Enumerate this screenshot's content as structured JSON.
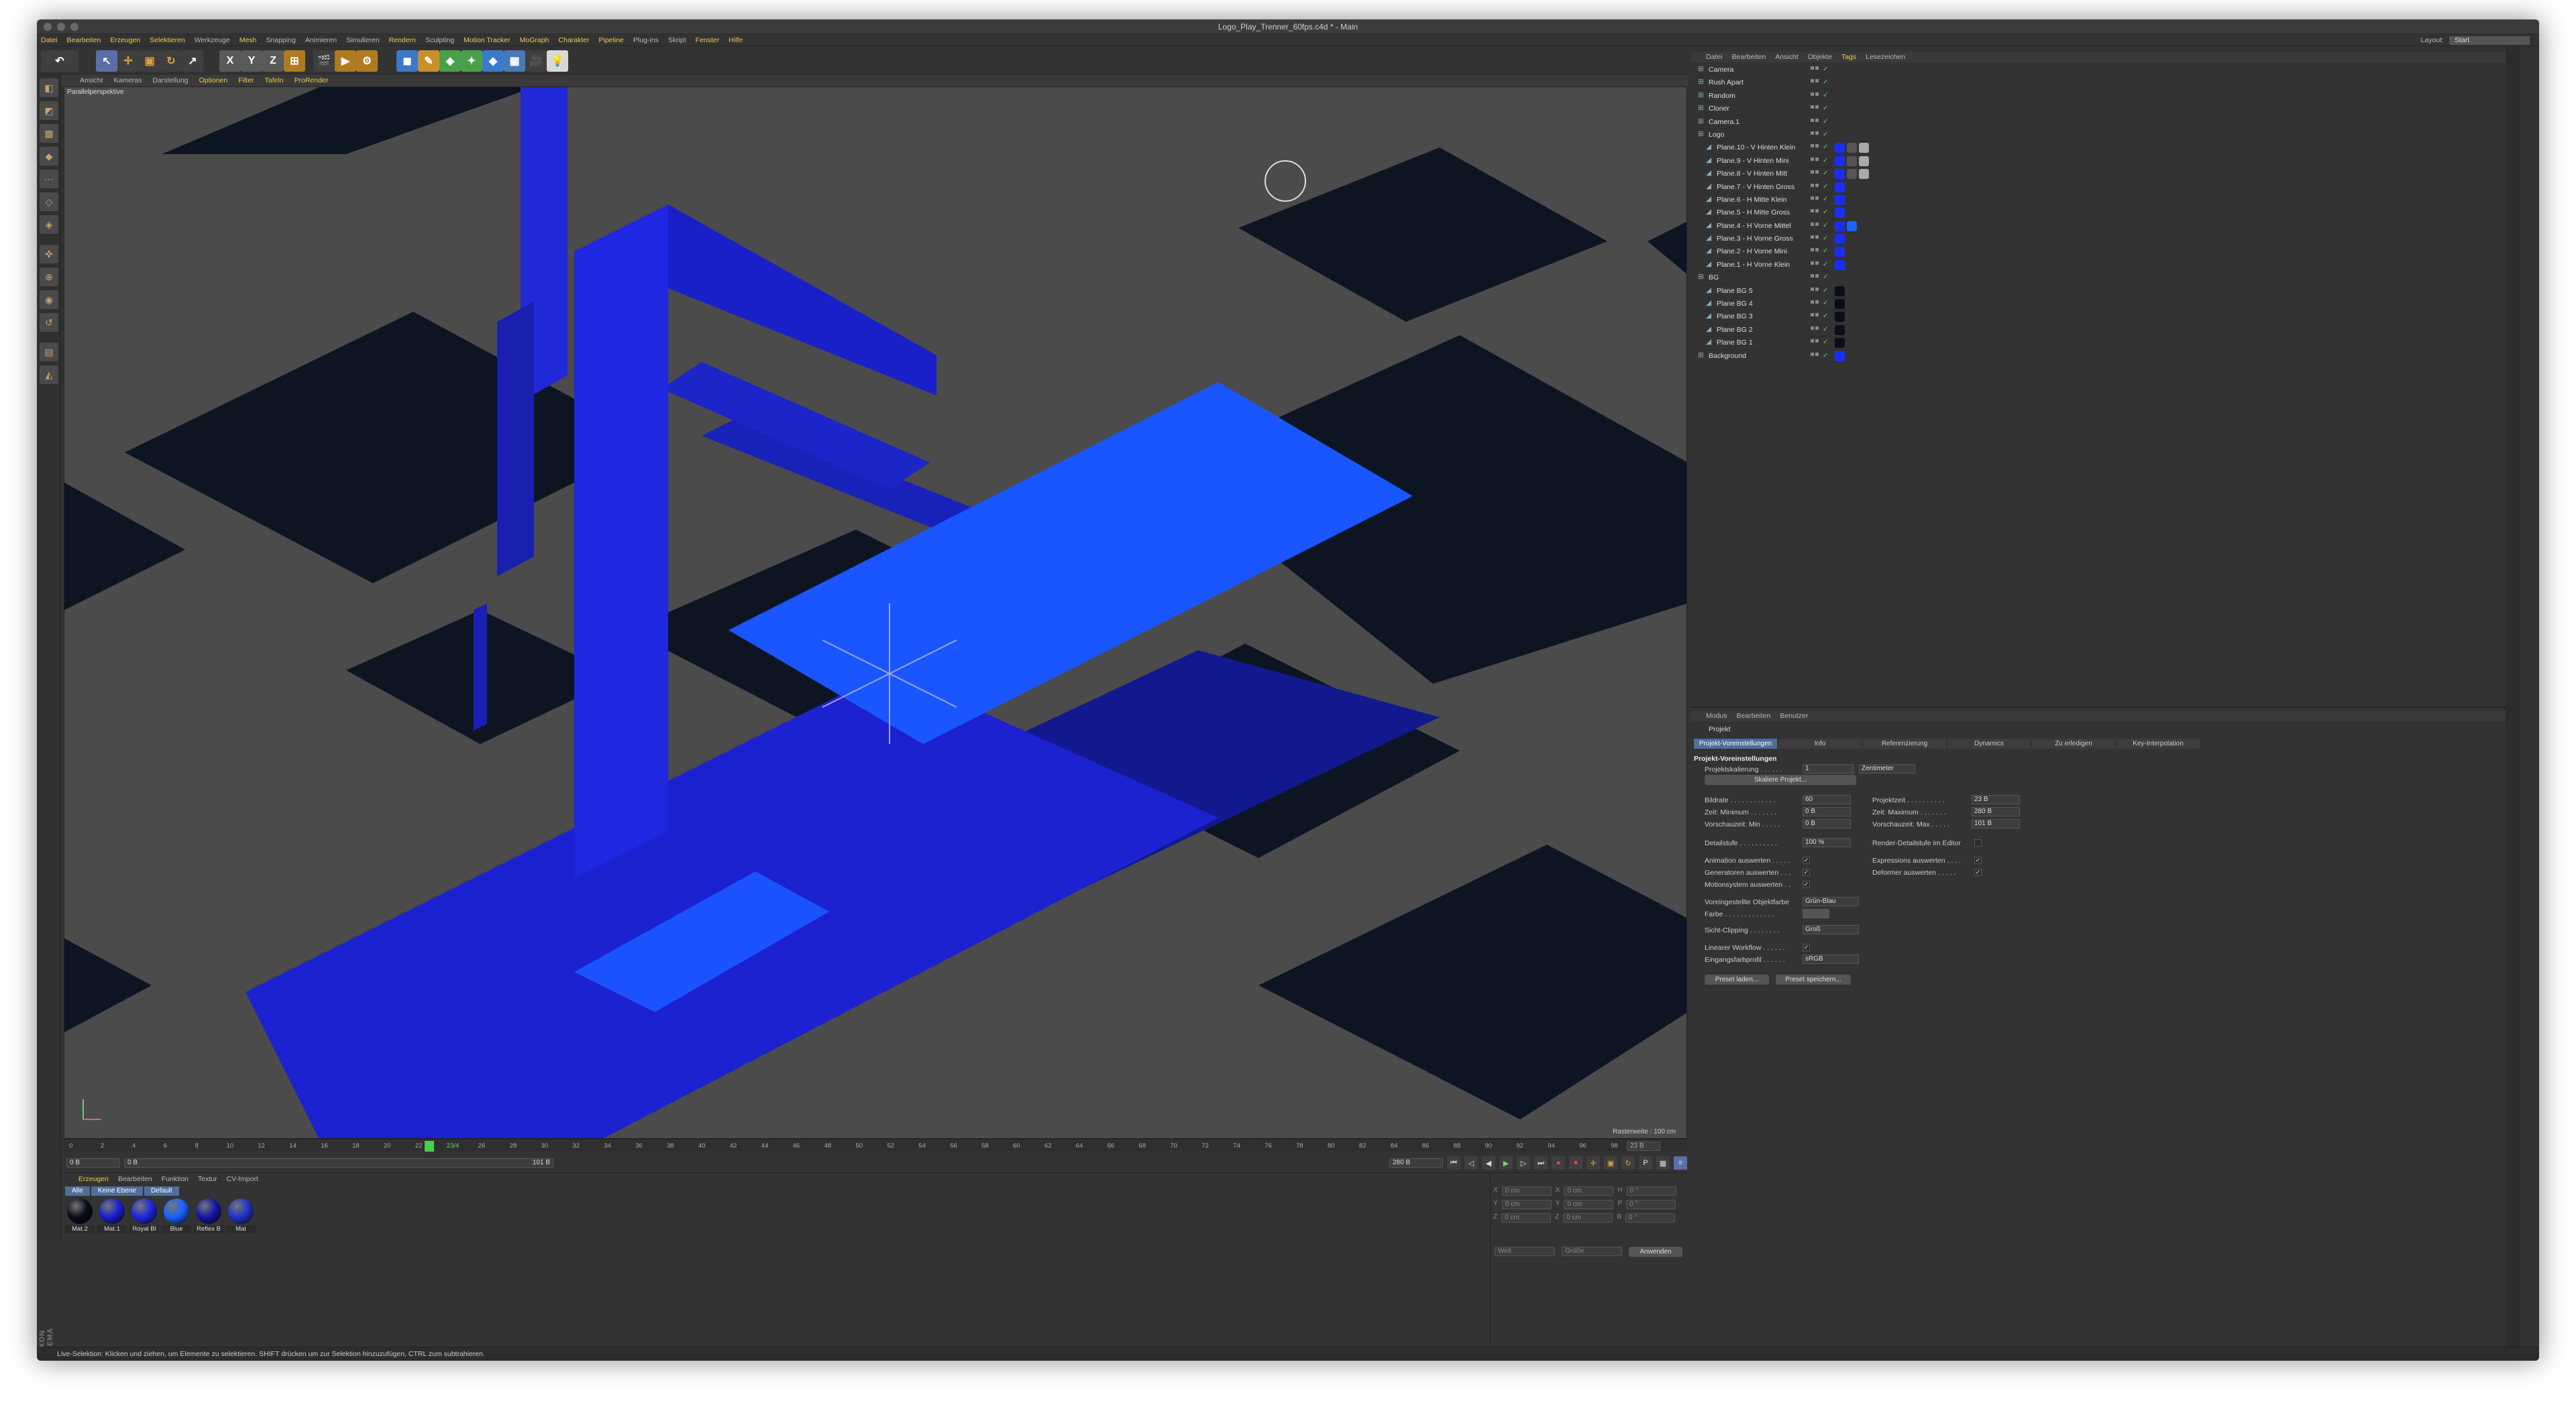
{
  "window": {
    "title": "Logo_Play_Trenner_60fps.c4d * - Main"
  },
  "menu": [
    "Datei",
    "Bearbeiten",
    "Erzeugen",
    "Selektieren",
    "Werkzeuge",
    "Mesh",
    "Snapping",
    "Animieren",
    "Simulieren",
    "Rendern",
    "Sculpting",
    "Motion Tracker",
    "MoGraph",
    "Charakter",
    "Pipeline",
    "Plug-ins",
    "Skript",
    "Fenster",
    "Hilfe"
  ],
  "layout": {
    "label": "Layout:",
    "value": "Start"
  },
  "viewport": {
    "menu": [
      "Ansicht",
      "Kameras",
      "Darstellung",
      "Optionen",
      "Filter",
      "Tafeln",
      "ProRender"
    ],
    "label": "Parallelperspektive",
    "grid_info": "Rasterweite : 100 cm"
  },
  "timeline": {
    "ticks": [
      "0",
      "2",
      "4",
      "6",
      "8",
      "10",
      "12",
      "14",
      "16",
      "18",
      "20",
      "22",
      "23/4",
      "26",
      "28",
      "30",
      "32",
      "34",
      "36",
      "38",
      "40",
      "42",
      "44",
      "46",
      "48",
      "50",
      "52",
      "54",
      "56",
      "58",
      "60",
      "62",
      "64",
      "66",
      "68",
      "70",
      "72",
      "74",
      "76",
      "78",
      "80",
      "82",
      "84",
      "86",
      "88",
      "90",
      "92",
      "94",
      "96",
      "98",
      "100"
    ],
    "current_frame": "23 B",
    "start_field": "0 B",
    "min_field": "0 B",
    "range_end": "101 B",
    "end_field": "280 B"
  },
  "material_manager": {
    "menu": [
      "Erzeugen",
      "Bearbeiten",
      "Funktion",
      "Textur",
      "CV-Import"
    ],
    "filters": [
      "Alle",
      "Keine Ebene",
      "Default"
    ],
    "materials": [
      {
        "name": "Mat.2",
        "color": "#0b0d1a"
      },
      {
        "name": "Mat.1",
        "color": "#1a1fd0"
      },
      {
        "name": "Royal Bl",
        "color": "#1f27e0"
      },
      {
        "name": "Blue",
        "color": "#1a63ff"
      },
      {
        "name": "Reflex B",
        "color": "#1616a8"
      },
      {
        "name": "Mat",
        "color": "#2233cc"
      }
    ]
  },
  "coords": {
    "rows": [
      {
        "a": "X",
        "av": "0 cm",
        "b": "X",
        "bv": "0 cm",
        "c": "H",
        "cv": "0 °"
      },
      {
        "a": "Y",
        "av": "0 cm",
        "b": "Y",
        "bv": "0 cm",
        "c": "P",
        "cv": "0 °"
      },
      {
        "a": "Z",
        "av": "0 cm",
        "b": "Z",
        "bv": "0 cm",
        "c": "B",
        "cv": "0 °"
      }
    ],
    "sel1": "Welt",
    "sel2": "Größe",
    "apply": "Anwenden"
  },
  "statusbar": "Live-Selektion: Klicken und ziehen, um Elemente zu selektieren. SHIFT drücken um zur Selektion hinzuzufügen, CTRL zum subtrahieren.",
  "brand": "MAXON CINEMA 4D",
  "object_manager": {
    "menu": [
      "Datei",
      "Bearbeiten",
      "Ansicht",
      "Objekte",
      "Tags",
      "Lesezeichen"
    ],
    "objects": [
      {
        "name": "Camera",
        "indent": 0,
        "tags": []
      },
      {
        "name": "Rush Apart",
        "indent": 0,
        "tags": []
      },
      {
        "name": "Random",
        "indent": 0,
        "tags": []
      },
      {
        "name": "Cloner",
        "indent": 0,
        "tags": []
      },
      {
        "name": "Camera.1",
        "indent": 0,
        "tags": []
      },
      {
        "name": "Logo",
        "indent": 0,
        "tags": []
      },
      {
        "name": "Plane.10 - V Hinten Klein",
        "indent": 1,
        "tags": [
          "#1a2dff",
          "#555",
          "#aaa"
        ]
      },
      {
        "name": "Plane.9 - V Hinten Mini",
        "indent": 1,
        "tags": [
          "#1a2dff",
          "#555",
          "#aaa"
        ]
      },
      {
        "name": "Plane.8 - V Hinten Mitt",
        "indent": 1,
        "tags": [
          "#1a2dff",
          "#555",
          "#aaa"
        ]
      },
      {
        "name": "Plane.7 - V Hinten Gross",
        "indent": 1,
        "tags": [
          "#1a2dff"
        ]
      },
      {
        "name": "Plane.6 - H Mitte Klein",
        "indent": 1,
        "tags": [
          "#1a2dff"
        ]
      },
      {
        "name": "Plane.5 - H Mitte Gross",
        "indent": 1,
        "tags": [
          "#1a2dff"
        ]
      },
      {
        "name": "Plane.4 - H Vorne Mittel",
        "indent": 1,
        "tags": [
          "#1a2dff",
          "#1a63ff"
        ]
      },
      {
        "name": "Plane.3 - H Vorne Gross",
        "indent": 1,
        "tags": [
          "#1a2dff"
        ]
      },
      {
        "name": "Plane.2 - H Vorne Mini",
        "indent": 1,
        "tags": [
          "#1a2dff"
        ]
      },
      {
        "name": "Plane.1 - H Vorne Klein",
        "indent": 1,
        "tags": [
          "#1a2dff"
        ]
      },
      {
        "name": "BG",
        "indent": 0,
        "tags": []
      },
      {
        "name": "Plane BG 5",
        "indent": 1,
        "tags": [
          "#0b0d1a"
        ]
      },
      {
        "name": "Plane BG 4",
        "indent": 1,
        "tags": [
          "#0b0d1a"
        ]
      },
      {
        "name": "Plane BG 3",
        "indent": 1,
        "tags": [
          "#0b0d1a"
        ]
      },
      {
        "name": "Plane BG 2",
        "indent": 1,
        "tags": [
          "#0b0d1a"
        ]
      },
      {
        "name": "Plane BG 1",
        "indent": 1,
        "tags": [
          "#0b0d1a"
        ]
      },
      {
        "name": "Background",
        "indent": 0,
        "tags": [
          "#1a2dff"
        ]
      }
    ]
  },
  "attributes": {
    "menu": [
      "Modus",
      "Bearbeiten",
      "Benutzer"
    ],
    "object": "Projekt",
    "tabs": [
      "Projekt-Voreinstellungen",
      "Info",
      "Referenzierung",
      "Dynamics",
      "Zu erledigen",
      "Key-Interpolation"
    ],
    "section": "Projekt-Voreinstellungen",
    "projektskalierung_label": "Projektskalierung . . . . . .",
    "projektskalierung_val": "1",
    "projektskalierung_unit": "Zentimeter",
    "skaliere_btn": "Skaliere Projekt...",
    "bildrate_label": "Bildrate . . . . . . . . . . . .",
    "bildrate": "60",
    "projektzeit_label": "Projektzeit . . . . . . . . . .",
    "projektzeit": "23 B",
    "zeitmin_label": "Zeit: Minimum . . . . . . .",
    "zeitmin": "0 B",
    "zeitmax_label": "Zeit: Maximum . . . . . . .",
    "zeitmax": "280 B",
    "vormin_label": "Vorschauzeit: Min . . . . .",
    "vormin": "0 B",
    "vormax_label": "Vorschauzeit: Max . . . . .",
    "vormax": "101 B",
    "detail_label": "Detailstufe . . . . . . . . . .",
    "detail": "100 %",
    "renderdetail_label": "Render-Detailstufe im Editor",
    "anim_label": "Animation auswerten . . . . .",
    "expr_label": "Expressions auswerten . . . .",
    "gen_label": "Generatoren auswerten . . .",
    "deform_label": "Deformer auswerten . . . . .",
    "motion_label": "Motionsystem auswerten . .",
    "objfarbe_label": "Voreingestellte Objektfarbe",
    "objfarbe": "Grün-Blau",
    "farbe_label": "Farbe . . . . . . . . . . . . .",
    "clip_label": "Sicht-Clipping . . . . . . . .",
    "clip": "Groß",
    "linear_label": "Linearer Workflow . . . . . .",
    "eingang_label": "Eingangsfarbprofil . . . . . .",
    "eingang": "sRGB",
    "preset_load": "Preset laden...",
    "preset_save": "Preset speichern..."
  }
}
